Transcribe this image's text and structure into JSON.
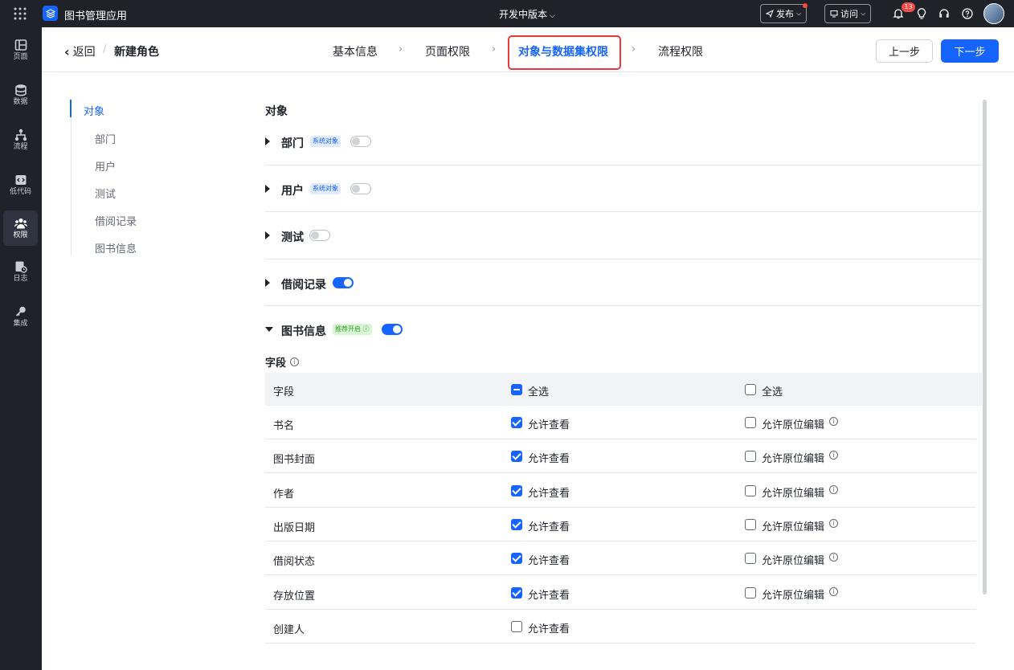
{
  "topbar": {
    "app_name": "图书管理应用",
    "version": "开发中版本",
    "publish": "发布",
    "visit": "访问",
    "notification_count": "13"
  },
  "sidebar": {
    "items": [
      {
        "label": "页面"
      },
      {
        "label": "数据"
      },
      {
        "label": "流程"
      },
      {
        "label": "低代码"
      },
      {
        "label": "权限"
      },
      {
        "label": "日志"
      },
      {
        "label": "集成"
      }
    ]
  },
  "header": {
    "back": "返回",
    "separator": "/",
    "title": "新建角色",
    "steps": [
      "基本信息",
      "页面权限",
      "对象与数据集权限",
      "流程权限"
    ],
    "active_step": "对象与数据集权限",
    "prev": "上一步",
    "next": "下一步"
  },
  "anchor_nav": {
    "items": [
      "对象",
      "部门",
      "用户",
      "测试",
      "借阅记录",
      "图书信息"
    ]
  },
  "content": {
    "section_title": "对象",
    "objects": [
      {
        "name": "部门",
        "tag": "系统对象",
        "enabled": false,
        "expanded": false
      },
      {
        "name": "用户",
        "tag": "系统对象",
        "enabled": false,
        "expanded": false
      },
      {
        "name": "测试",
        "tag": "",
        "enabled": false,
        "expanded": false
      },
      {
        "name": "借阅记录",
        "tag": "",
        "enabled": true,
        "expanded": false
      },
      {
        "name": "图书信息",
        "tag": "推荐开启 ⓘ",
        "enabled": true,
        "expanded": true
      }
    ],
    "fields_label": "字段",
    "table": {
      "col_field": "字段",
      "col_view_all": "全选",
      "col_edit_all": "全选",
      "view_label": "允许查看",
      "edit_label": "允许原位编辑",
      "rows": [
        {
          "name": "书名",
          "view": true,
          "edit": false
        },
        {
          "name": "图书封面",
          "view": true,
          "edit": false
        },
        {
          "name": "作者",
          "view": true,
          "edit": false
        },
        {
          "name": "出版日期",
          "view": true,
          "edit": false
        },
        {
          "name": "借阅状态",
          "view": true,
          "edit": false
        },
        {
          "name": "存放位置",
          "view": true,
          "edit": false
        },
        {
          "name": "创建人",
          "view": false,
          "edit": null
        }
      ]
    }
  },
  "colors": {
    "accent": "#1664ff",
    "dark_bg": "#1f2329",
    "highlight": "#e63a3a",
    "recommend_tag": "#2ea121"
  }
}
